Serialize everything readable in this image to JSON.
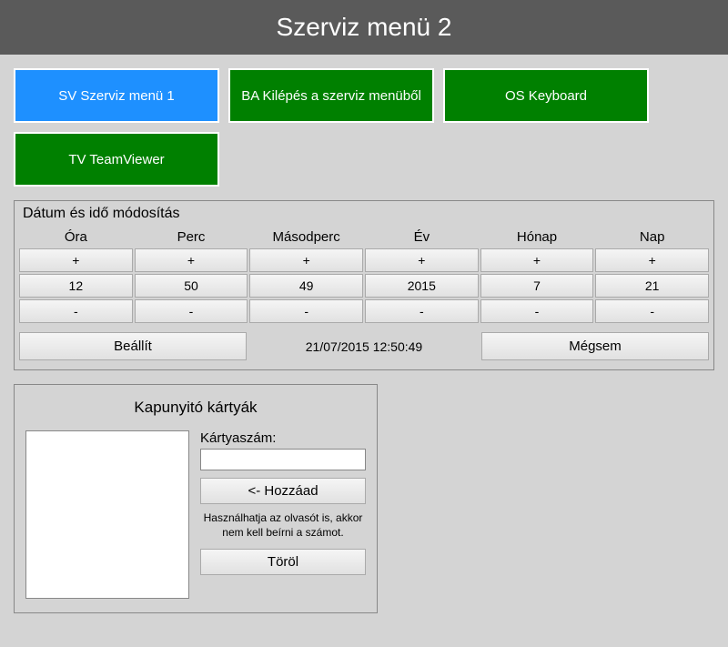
{
  "header": {
    "title": "Szerviz menü 2"
  },
  "buttons": {
    "service_menu_1": "SV Szerviz menü 1",
    "exit": "BA Kilépés a szerviz menüből",
    "keyboard": "OS Keyboard",
    "teamviewer": "TV TeamViewer"
  },
  "datetime": {
    "panel_title": "Dátum és idő módosítás",
    "columns": [
      "Óra",
      "Perc",
      "Másodperc",
      "Év",
      "Hónap",
      "Nap"
    ],
    "plus": "+",
    "minus": "-",
    "values": [
      "12",
      "50",
      "49",
      "2015",
      "7",
      "21"
    ],
    "set_label": "Beállít",
    "timestamp": "21/07/2015 12:50:49",
    "cancel_label": "Mégsem"
  },
  "cards": {
    "panel_title": "Kapunyitó kártyák",
    "field_label": "Kártyaszám:",
    "add_label": "<- Hozzáad",
    "hint": "Használhatja az olvasót is, akkor nem kell beírni a számot.",
    "delete_label": "Töröl",
    "input_value": ""
  }
}
